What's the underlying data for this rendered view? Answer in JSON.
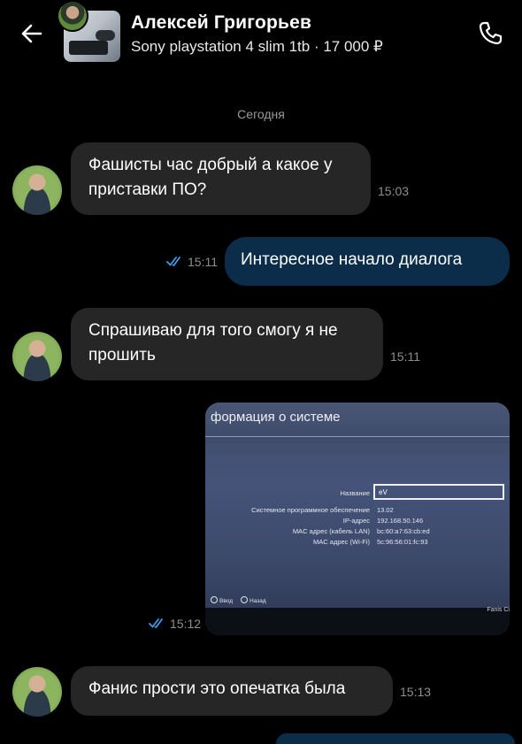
{
  "header": {
    "contact_name": "Алексей Григорьев",
    "item_subtitle": "Sony playstation 4 slim 1tb · 17 000 ₽",
    "back_icon": "arrow-left-icon",
    "call_icon": "phone-icon"
  },
  "date_separator": "Сегодня",
  "messages": [
    {
      "direction": "in",
      "text": "Фашисты час добрый а какое у приставки ПО?",
      "time": "15:03"
    },
    {
      "direction": "out",
      "text": "Интересное начало диалога",
      "time": "15:11",
      "read": true
    },
    {
      "direction": "in",
      "text": "Спрашиваю для того смогу я не прошить",
      "time": "15:11"
    },
    {
      "direction": "out",
      "type": "photo",
      "time": "15:12",
      "read": true,
      "photo": {
        "title": "формация о системе",
        "rows": [
          {
            "label": "Название",
            "value": "eV"
          },
          {
            "label": "Системное программное обеспечение",
            "value": "13.02"
          },
          {
            "label": "IP-адрес",
            "value": "192.168.50.146"
          },
          {
            "label": "MAC адрес (кабель LAN)",
            "value": "bc:60:a7:63:cb:ed"
          },
          {
            "label": "MAC адрес (Wi-Fi)",
            "value": "5c:96:56:01:fc:93"
          }
        ],
        "btn_enter": "Ввод",
        "btn_back": "Назад",
        "corner_text": "Fanis Ci"
      }
    },
    {
      "direction": "in",
      "text": "Фанис прости это опечатка была",
      "time": "15:13"
    }
  ],
  "colors": {
    "background": "#000000",
    "incoming_bubble": "#262626",
    "outgoing_bubble": "#0b2d4a",
    "read_check": "#3d9be9",
    "meta_text": "#8e8e8e"
  }
}
